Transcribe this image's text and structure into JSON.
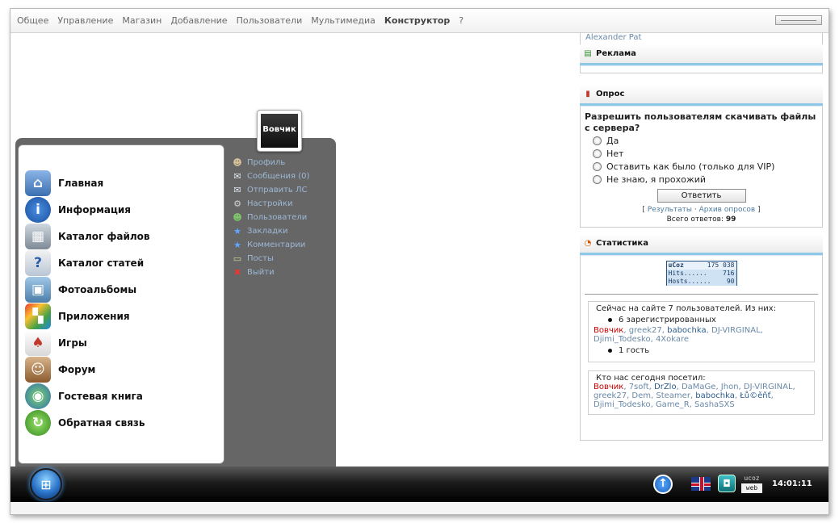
{
  "topmenu": {
    "items": [
      "Общее",
      "Управление",
      "Магазин",
      "Добавление",
      "Пользователи",
      "Мультимедиа",
      "Конструктор",
      "?"
    ],
    "active_index": 6
  },
  "sidebar": {
    "user_strip": "Alexander Pat",
    "ad_block": {
      "title": "Реклама"
    },
    "poll": {
      "title": "Опрос",
      "question": "Разрешить пользователям скачивать файлы с сервера?",
      "options": [
        "Да",
        "Нет",
        "Оставить как было (только для VIP)",
        "Не знаю, я прохожий"
      ],
      "vote_label": "Ответить",
      "results_link": "Результаты",
      "archive_link": "Архив опросов",
      "total_label": "Всего ответов:",
      "total_value": "99"
    },
    "stats": {
      "title": "Статистика",
      "counter": {
        "brand": "uCoz",
        "total": "175 038",
        "hits_label": "Hits......",
        "hits": "716",
        "hosts_label": "Hosts......",
        "hosts": "90"
      },
      "online_legend": "Сейчас на сайте 7 пользователей. Из них:",
      "registered": "6 зарегистрированных",
      "online_users": [
        "Вовчик",
        "greek27",
        "babochka",
        "DJ-VIRGINAL",
        "Djimi_Todesko",
        "4Xokare"
      ],
      "guests": "1 гость",
      "today_legend": "Кто нас сегодня посетил:",
      "today_users": [
        "Вовчик",
        "7soft",
        "DrZlo",
        "DaMaGe",
        "Jhon",
        "DJ-VIRGINAL",
        "greek27",
        "Dem",
        "Steamer",
        "babochka",
        "Łů©ěňť",
        "Djimi_Todesko",
        "Game_R",
        "SashaSXS"
      ]
    }
  },
  "startmenu": {
    "avatar_text": "Вовчик",
    "left_items": [
      "Главная",
      "Информация",
      "Каталог файлов",
      "Каталог статей",
      "Фотоальбомы",
      "Приложения",
      "Игры",
      "Форум",
      "Гостевая книга",
      "Обратная связь"
    ],
    "right_links": [
      "Профиль",
      "Сообщения (0)",
      "Отправить ЛС",
      "Настройки",
      "Пользователи",
      "Закладки",
      "Комментарии",
      "Посты",
      "Выйти"
    ]
  },
  "taskbar": {
    "clock": "14:01:11",
    "ucoz_top": "ucoz",
    "ucoz_bottom": "web"
  },
  "colors": {
    "accent": "#8ec8e8",
    "link": "#6a89a8",
    "online_red": "#cc0000",
    "startmenu_bg": "#666666"
  }
}
